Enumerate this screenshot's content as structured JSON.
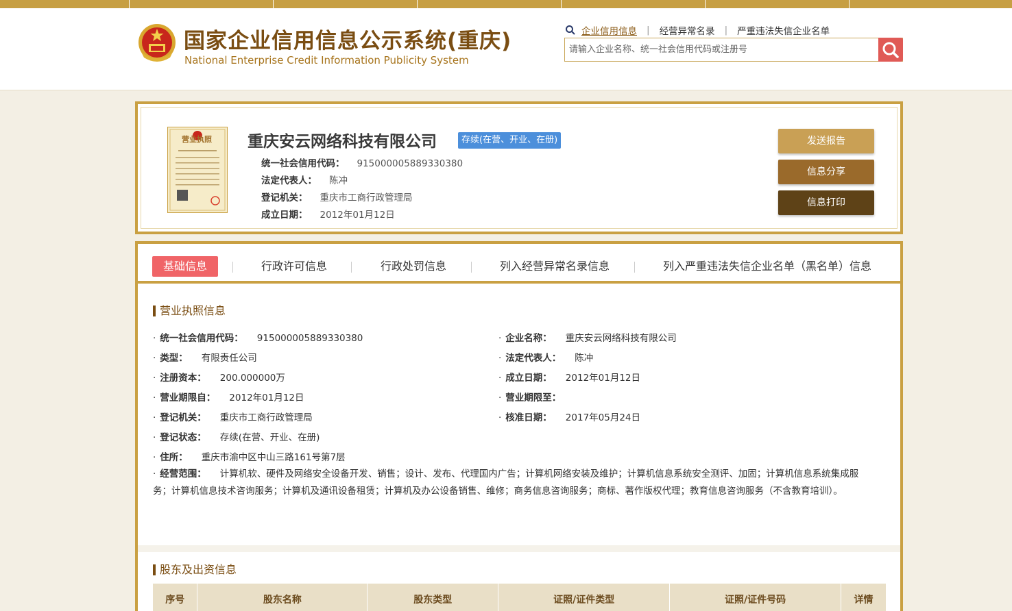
{
  "header": {
    "title_cn": "国家企业信用信息公示系统(重庆)",
    "title_en": "National Enterprise Credit Information Publicity System",
    "nav": [
      {
        "label": "企业信用信息",
        "active": true
      },
      {
        "label": "经营异常名录",
        "active": false
      },
      {
        "label": "严重违法失信企业名单",
        "active": false
      }
    ],
    "search_placeholder": "请输入企业名称、统一社会信用代码或注册号"
  },
  "company": {
    "name": "重庆安云网络科技有限公司",
    "status": "存续(在营、开业、在册)",
    "fields": [
      {
        "label": "统一社会信用代码：",
        "value": "915000005889330380"
      },
      {
        "label": "法定代表人：",
        "value": "陈冲"
      },
      {
        "label": "登记机关：",
        "value": "重庆市工商行政管理局"
      },
      {
        "label": "成立日期：",
        "value": "2012年01月12日"
      }
    ],
    "license_title": "营业执照",
    "buttons": [
      "发送报告",
      "信息分享",
      "信息打印"
    ]
  },
  "tabs": [
    "基础信息",
    "行政许可信息",
    "行政处罚信息",
    "列入经营异常名录信息",
    "列入严重违法失信企业名单（黑名单）信息"
  ],
  "license_section": {
    "title": "营业执照信息",
    "left": [
      {
        "label": "统一社会信用代码：",
        "value": "915000005889330380"
      },
      {
        "label": "类型：",
        "value": "有限责任公司"
      },
      {
        "label": "注册资本：",
        "value": "200.000000万"
      },
      {
        "label": "营业期限自：",
        "value": "2012年01月12日"
      },
      {
        "label": "登记机关：",
        "value": "重庆市工商行政管理局"
      },
      {
        "label": "登记状态：",
        "value": "存续(在营、开业、在册)"
      },
      {
        "label": "住所：",
        "value": "重庆市渝中区中山三路161号第7层"
      }
    ],
    "right": [
      {
        "label": "企业名称：",
        "value": "重庆安云网络科技有限公司"
      },
      {
        "label": "法定代表人：",
        "value": "陈冲"
      },
      {
        "label": "成立日期：",
        "value": "2012年01月12日"
      },
      {
        "label": "营业期限至：",
        "value": ""
      },
      {
        "label": "核准日期：",
        "value": "2017年05月24日"
      }
    ],
    "scope_label": "经营范围：",
    "scope_value": "计算机软、硬件及网络安全设备开发、销售；设计、发布、代理国内广告；计算机网络安装及维护；计算机信息系统安全测评、加固；计算机信息系统集成服务；计算机信息技术咨询服务；计算机及通讯设备租赁；计算机及办公设备销售、维修；商务信息咨询服务；商标、著作版权代理；教育信息咨询服务（不含教育培训）。"
  },
  "shareholder_section": {
    "title": "股东及出资信息",
    "columns": [
      "序号",
      "股东名称",
      "股东类型",
      "证照/证件类型",
      "证照/证件号码",
      "详情"
    ]
  },
  "colors": {
    "gold": "#c9a042",
    "brown": "#7a4d12",
    "badge": "#4c8fdb",
    "tab_active": "#f06467",
    "search_btn": "#e05a56"
  }
}
